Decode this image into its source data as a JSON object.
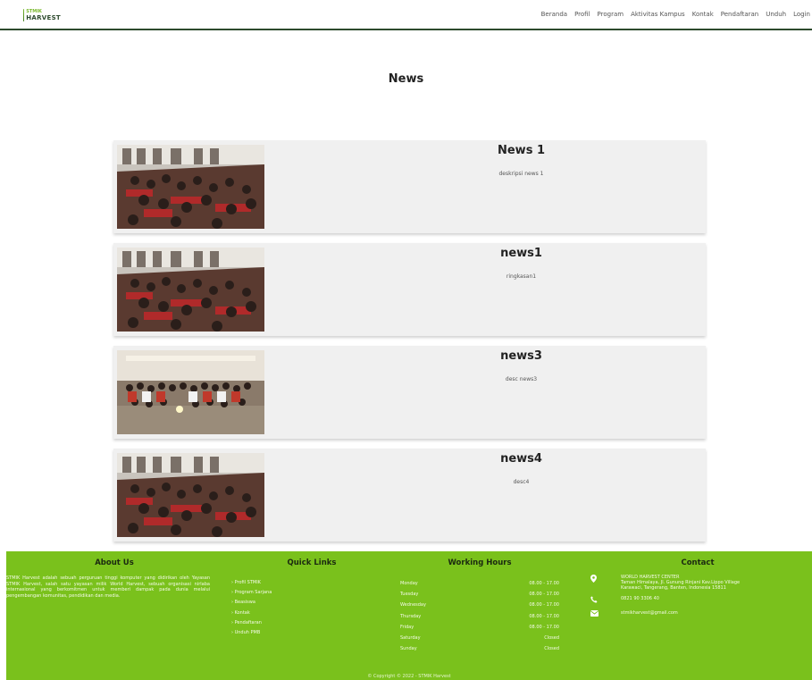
{
  "header": {
    "logo_line1": "STMIK",
    "logo_line2": "HARVEST",
    "nav": [
      "Beranda",
      "Profil",
      "Program",
      "Aktivitas Kampus",
      "Kontak",
      "Pendaftaran",
      "Unduh",
      "Login"
    ]
  },
  "page": {
    "title": "News"
  },
  "news": [
    {
      "title": "News 1",
      "desc": "deskripsi news 1"
    },
    {
      "title": "news1",
      "desc": "ringkasan1"
    },
    {
      "title": "news3",
      "desc": "desc news3"
    },
    {
      "title": "news4",
      "desc": "desc4"
    }
  ],
  "footer": {
    "about": {
      "title": "About Us",
      "text": "STMIK Harvest adalah sebuah perguruan tinggi komputer yang didirikan oleh Yayasan STMIK Harvest, salah satu yayasan milik World Harvest, sebuah organisasi nirlaba internasional yang berkomitmen untuk memberi dampak pada dunia melalui pengembangan komunitas, pendidikan dan media."
    },
    "quick_links": {
      "title": "Quick Links",
      "items": [
        "› Profil STMIK",
        "› Program Sarjana",
        "› Beasiswa",
        "› Kontak",
        "› Pendaftaran",
        "› Unduh PMB"
      ]
    },
    "hours": {
      "title": "Working Hours",
      "rows": [
        {
          "day": "Monday",
          "time": "08.00 - 17.00"
        },
        {
          "day": "Tuesday",
          "time": "08.00 - 17.00"
        },
        {
          "day": "Wednesday",
          "time": "08.00 - 17.00"
        },
        {
          "day": "Thursday",
          "time": "08.00 - 17.00"
        },
        {
          "day": "Friday",
          "time": "08.00 - 17.00"
        },
        {
          "day": "Saturday",
          "time": "Closed"
        },
        {
          "day": "Sunday",
          "time": "Closed"
        }
      ]
    },
    "contact": {
      "title": "Contact",
      "address_line1": "WORLD HARVEST CENTER",
      "address_line2": "Taman Himalaya, Jl. Gunung Rinjani Kav.Lippo Village",
      "address_line3": "Karawaci, Tangerang, Banten, Indonesia 15811",
      "phone": "0821 90 3306 40",
      "email": "stmikharvest@gmail.com"
    },
    "copyright": "© Copyright © 2022 - STMIK Harvest"
  }
}
